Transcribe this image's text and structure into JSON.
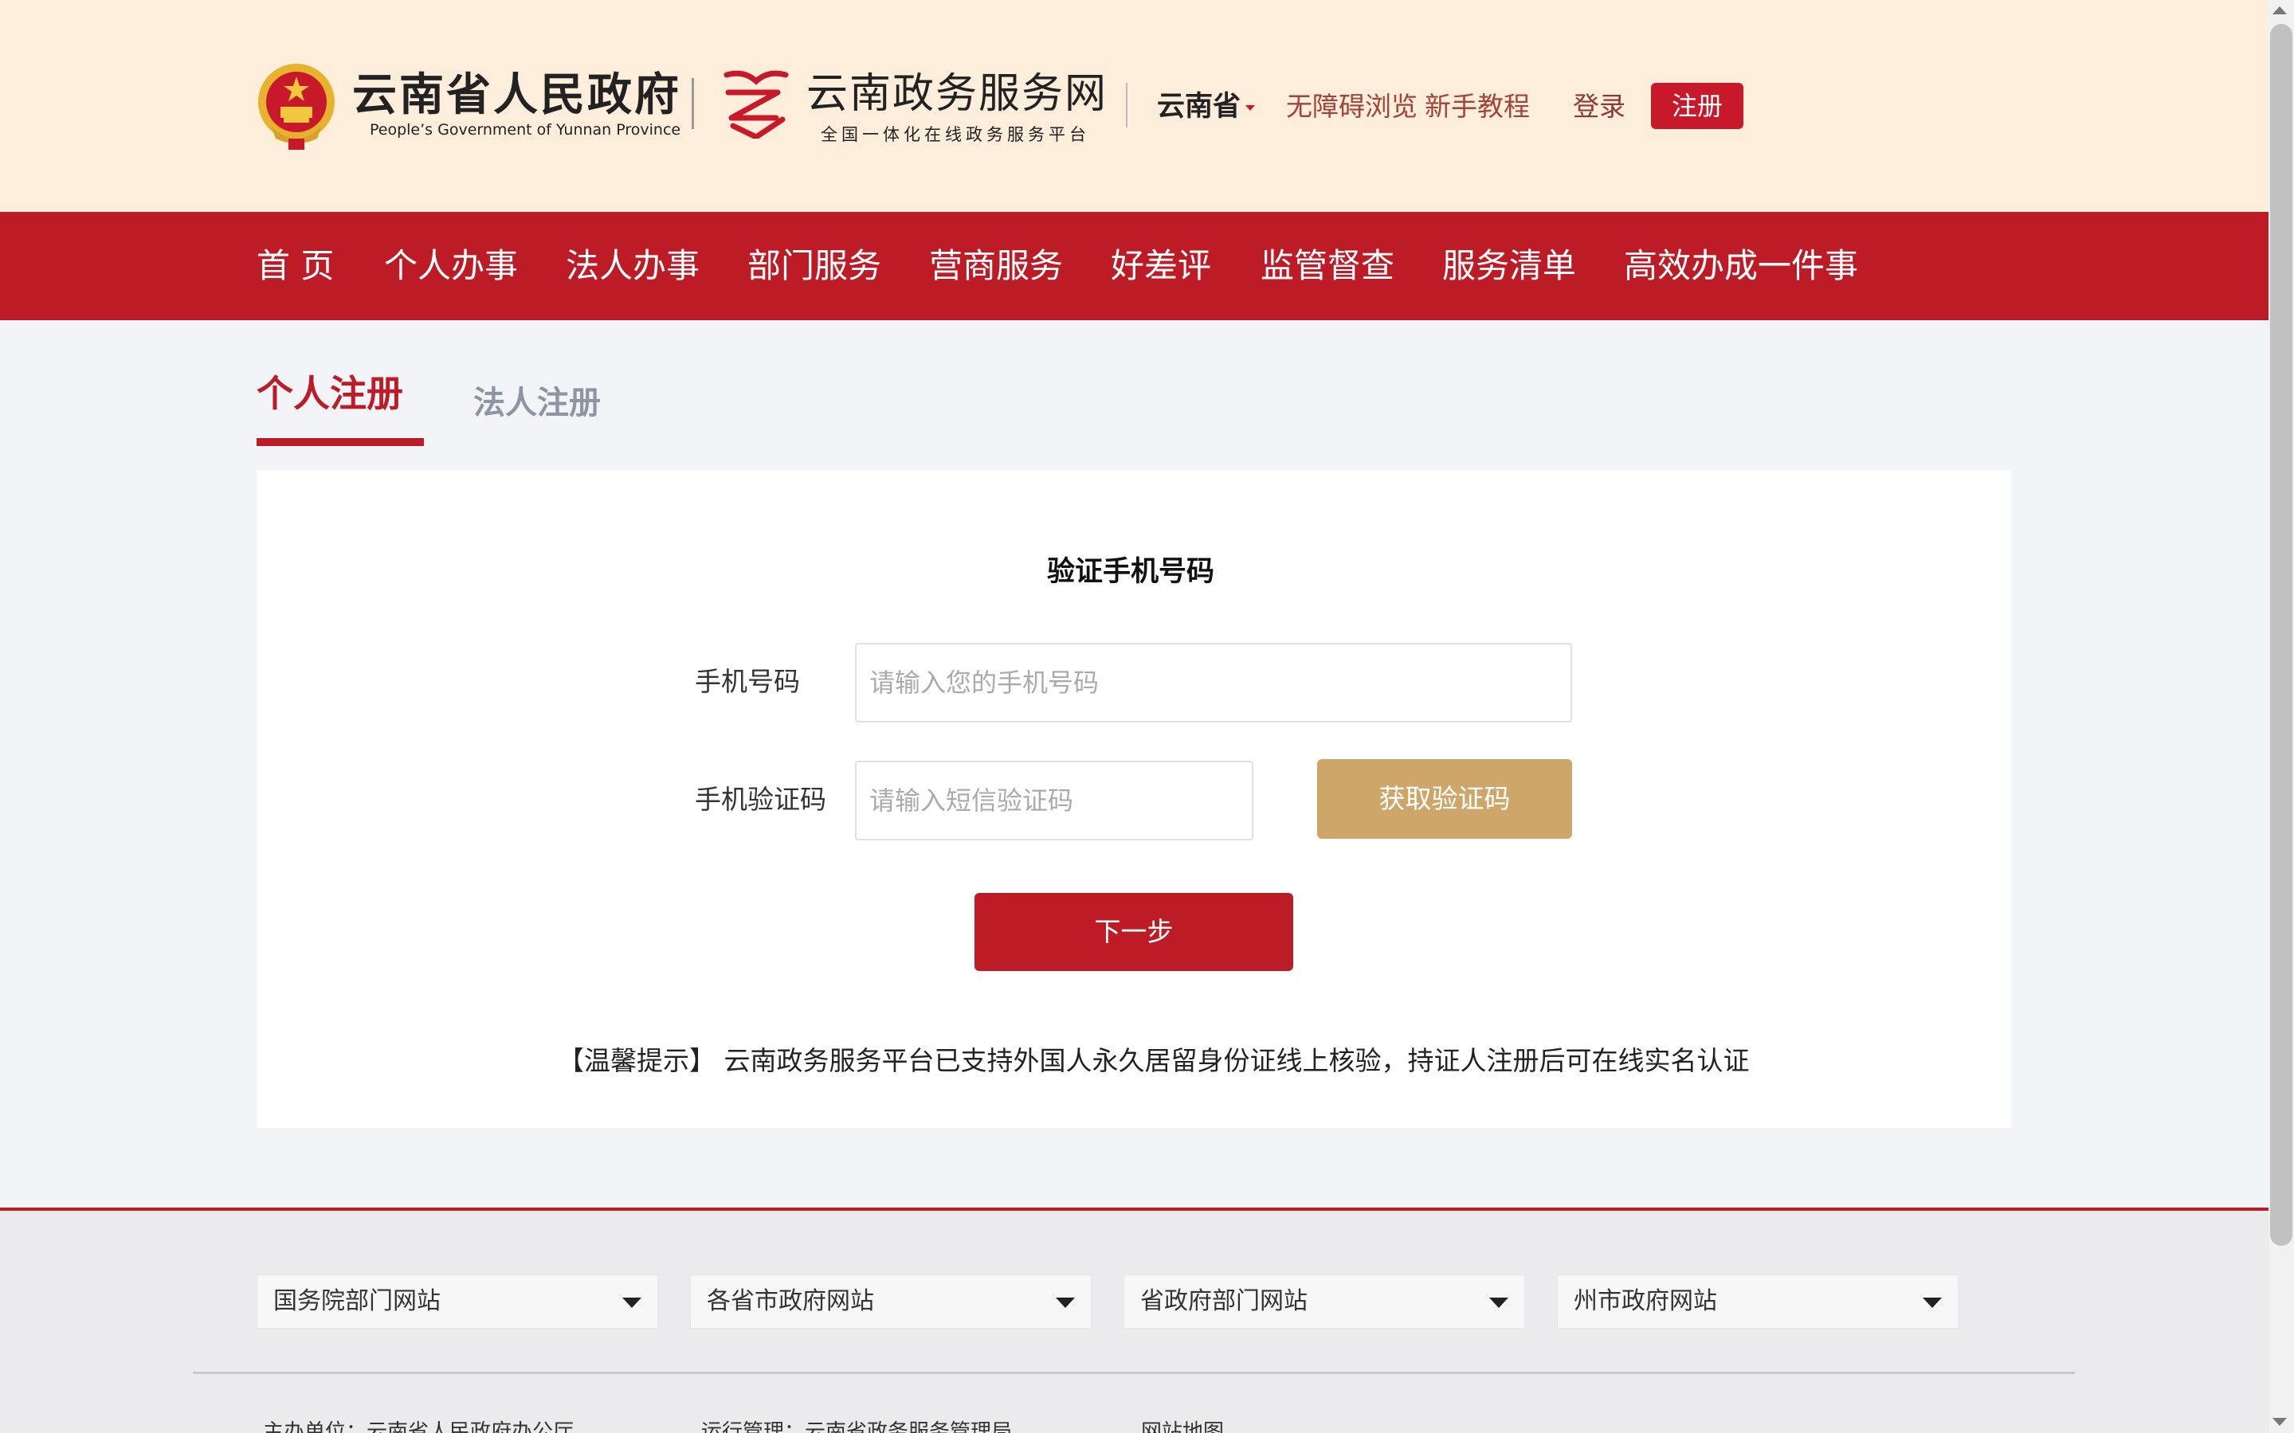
{
  "header": {
    "gov_title": "云南省人民政府",
    "gov_subtitle": "People’s Government of Yunnan Province",
    "service_title": "云南政务服务网",
    "service_subtitle": "全国一体化在线政务服务平台",
    "region": "云南省",
    "accessibility": "无障碍浏览",
    "tutorial": "新手教程",
    "login": "登录",
    "register": "注册"
  },
  "nav": {
    "items": [
      "首 页",
      "个人办事",
      "法人办事",
      "部门服务",
      "营商服务",
      "好差评",
      "监管督查",
      "服务清单",
      "高效办成一件事"
    ]
  },
  "tabs": {
    "active": "个人注册",
    "inactive": "法人注册"
  },
  "form": {
    "title": "验证手机号码",
    "phone_label": "手机号码",
    "phone_placeholder": "请输入您的手机号码",
    "code_label": "手机验证码",
    "code_placeholder": "请输入短信验证码",
    "get_code": "获取验证码",
    "next": "下一步",
    "tip": "【温馨提示】 云南政务服务平台已支持外国人永久居留身份证线上核验，持证人注册后可在线实名认证"
  },
  "footer": {
    "selects": [
      "国务院部门网站",
      "各省市政府网站",
      "省政府部门网站",
      "州市政府网站"
    ],
    "host_unit": "主办单位：云南省人民政府办公厅",
    "operator": "运行管理：云南省政务服务管理局",
    "sitemap": "网站地图"
  },
  "colors": {
    "brand_red": "#bd1c27",
    "header_bg": "#fdeedc",
    "gold_button": "#cfa66a"
  }
}
